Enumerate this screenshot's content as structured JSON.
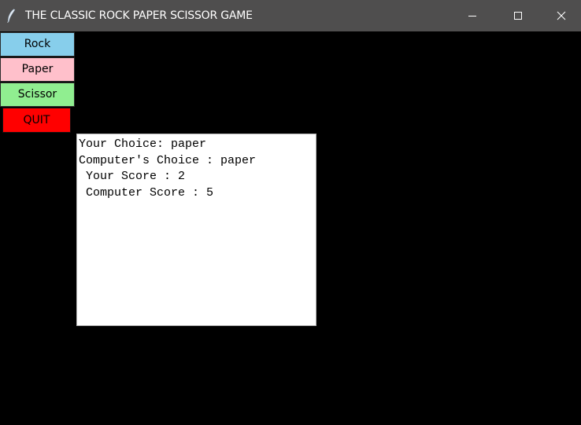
{
  "window": {
    "title": "THE CLASSIC ROCK PAPER SCISSOR GAME",
    "icon": "feather-icon",
    "controls": [
      "minimize-icon",
      "maximize-icon",
      "close-icon"
    ]
  },
  "buttons": {
    "rock": {
      "label": "Rock",
      "color": "#87ceeb"
    },
    "paper": {
      "label": "Paper",
      "color": "#ffc0cb"
    },
    "scissor": {
      "label": "Scissor",
      "color": "#90ee90"
    },
    "quit": {
      "label": "QUIT",
      "color": "#ff0000"
    }
  },
  "result": {
    "your_choice": "Your Choice: paper",
    "computer_choice": "Computer's Choice : paper",
    "your_score": " Your Score : 2",
    "computer_score": " Computer Score : 5"
  },
  "colors": {
    "titlebar": "#4f4e4e",
    "background": "#000000",
    "result_bg": "#ffffff"
  }
}
